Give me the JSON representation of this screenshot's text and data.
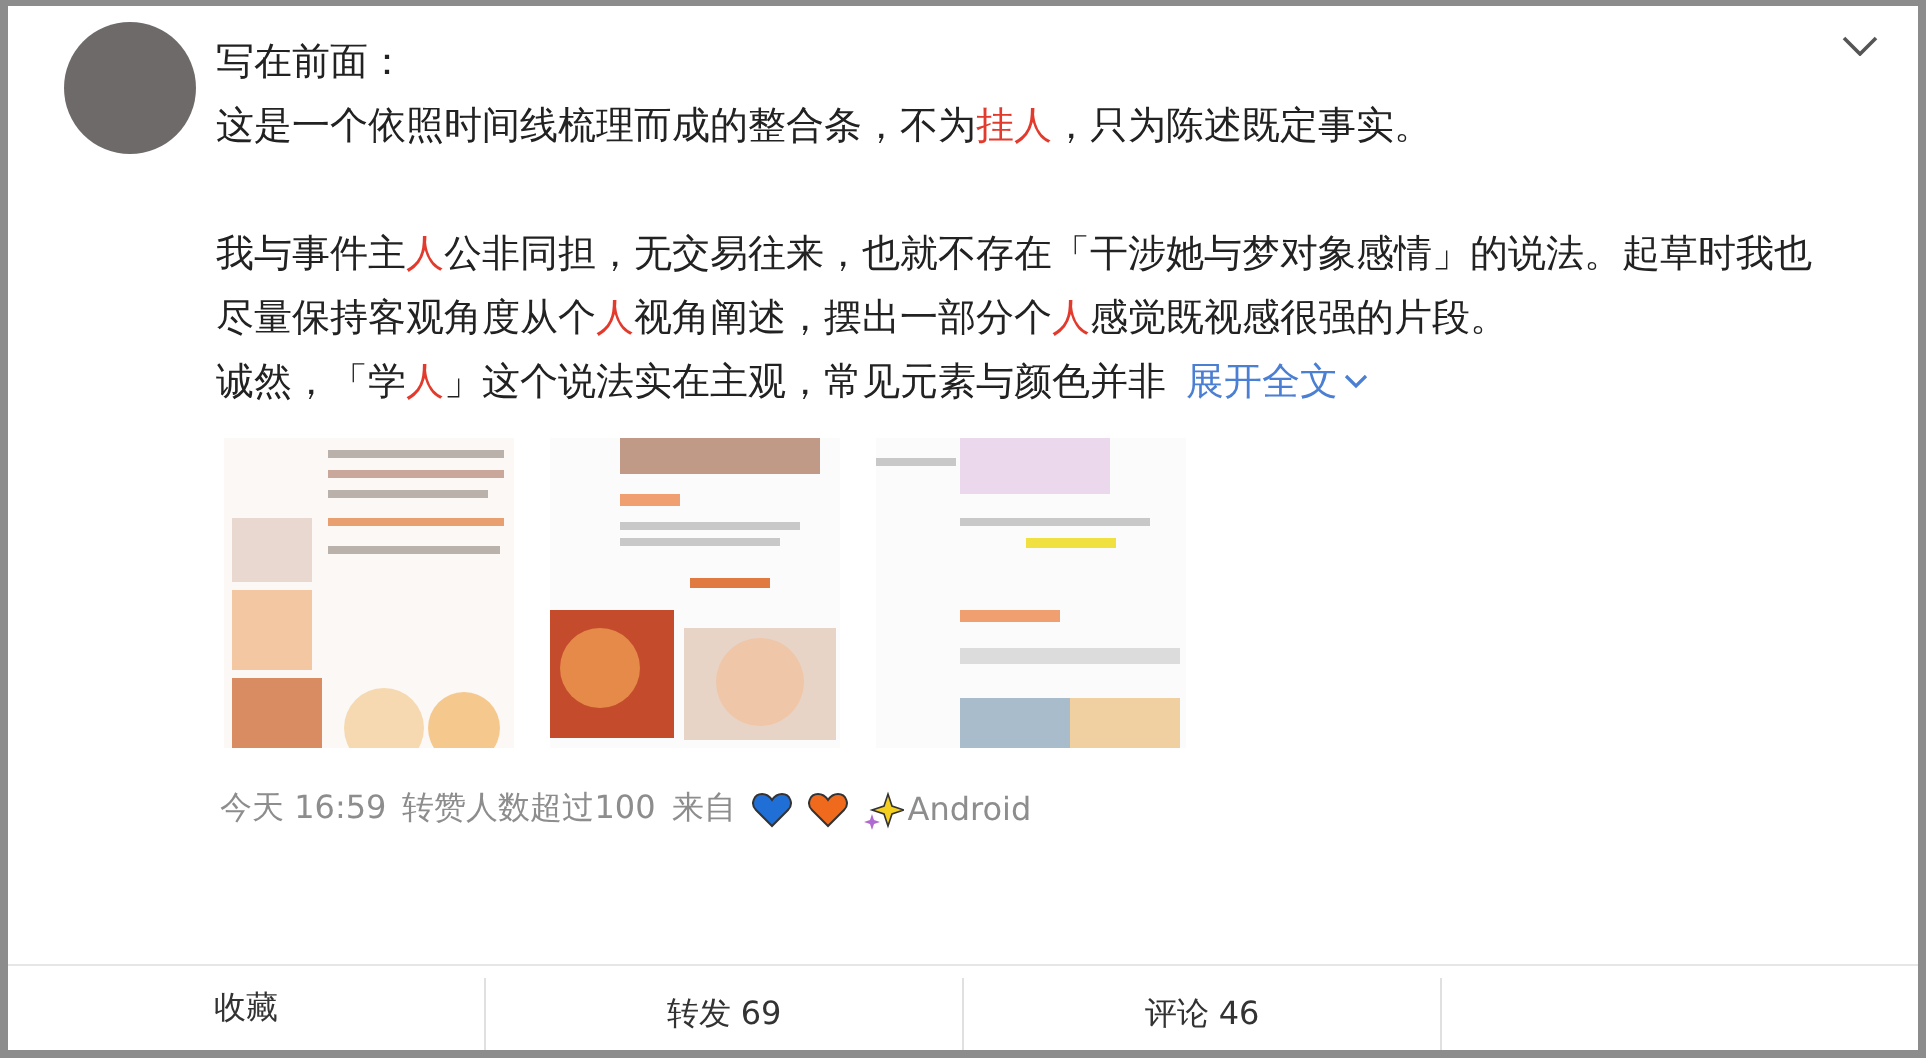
{
  "post": {
    "paragraphs": [
      {
        "lines": [
          {
            "segments": [
              {
                "text": "写在前面：",
                "highlight": false
              }
            ]
          },
          {
            "segments": [
              {
                "text": "这是一个依照时间线梳理而成的整合条，不为",
                "highlight": false
              },
              {
                "text": "挂人",
                "highlight": true
              },
              {
                "text": "，只为陈述既定事实。",
                "highlight": false
              }
            ]
          }
        ]
      },
      {
        "lines": [
          {
            "segments": [
              {
                "text": "我与事件主",
                "highlight": false
              },
              {
                "text": "人",
                "highlight": true
              },
              {
                "text": "公非同担，无交易往来，也就不存在「干涉她与梦对象感情」的说法。起草时我也",
                "highlight": false
              }
            ]
          },
          {
            "segments": [
              {
                "text": "尽量保持客观角度从个",
                "highlight": false
              },
              {
                "text": "人",
                "highlight": true
              },
              {
                "text": "视角阐述，摆出一部分个",
                "highlight": false
              },
              {
                "text": "人",
                "highlight": true
              },
              {
                "text": "感觉既视感很强的片段。",
                "highlight": false
              }
            ]
          },
          {
            "segments": [
              {
                "text": "诚然，「学",
                "highlight": false
              },
              {
                "text": "人",
                "highlight": true
              },
              {
                "text": "」这个说法实在主观，常见元素与颜色并非",
                "highlight": false
              }
            ]
          }
        ]
      }
    ],
    "expand_link": "展开全文",
    "meta": {
      "time": "今天 16:59",
      "reposts_note": "转赞人数超过100",
      "source_prefix": "来自",
      "source": "Android"
    }
  },
  "actions": [
    {
      "label": "收藏"
    },
    {
      "label": "转发 69"
    },
    {
      "label": "评论 46"
    }
  ]
}
